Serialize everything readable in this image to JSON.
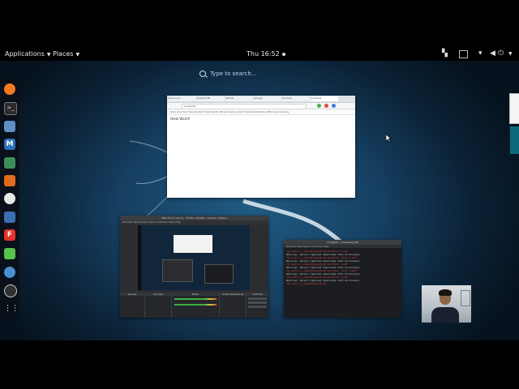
{
  "topbar": {
    "applications_label": "Applications",
    "places_label": "Places",
    "clock": "Thu 16:52"
  },
  "search": {
    "placeholder": "Type to search…"
  },
  "dock": {
    "apps": [
      {
        "name": "firefox-icon",
        "color": "#f47a22"
      },
      {
        "name": "terminal-icon",
        "color": "#2a2a2a"
      },
      {
        "name": "files-icon",
        "color": "#5f8fc4"
      },
      {
        "name": "metasploit-icon",
        "color": "#2d6fb8"
      },
      {
        "name": "armitage-icon",
        "color": "#3b8f5a"
      },
      {
        "name": "burpsuite-icon",
        "color": "#e26b1f"
      },
      {
        "name": "maltego-icon",
        "color": "#e8e8e8"
      },
      {
        "name": "beef-icon",
        "color": "#3a6fb0"
      },
      {
        "name": "faraday-icon",
        "color": "#e5332a"
      },
      {
        "name": "leafpad-icon",
        "color": "#59c24a"
      },
      {
        "name": "cherrytree-icon",
        "color": "#4a8fd0"
      },
      {
        "name": "obs-icon",
        "color": "#303030"
      },
      {
        "name": "show-apps-icon",
        "color": "#ffffff"
      }
    ]
  },
  "windows": {
    "browser": {
      "tabs": [
        "Kali Linux",
        "Exploit-DB",
        "GitHub",
        "Google",
        "YouTube",
        "localhost"
      ],
      "url": "localhost/",
      "bookmarks": "Kali Linux  Kali Training  Kali Tools  Exploit-DB  Aircrack-ng  Kali Forums  NetHunter  Offensive Security",
      "content_text": "Hello World!"
    },
    "obs": {
      "title": "OBS 22.0.3 (linux) - Profile: Untitled - Scenes: Untitled",
      "menu": "File  Edit  View  Profile  Scene Collection  Tools  Help",
      "panels": [
        "Scenes",
        "Sources",
        "Mixer",
        "Scene Transitions",
        "Controls"
      ]
    },
    "terminal": {
      "title": "root@kali: ~/Desktop/pdfs",
      "menu": "File  Edit  View  Search  Terminal  Help",
      "lines": [
        "r@-(kali)-[~/Desktop/pdfs]# exiftool 1.pdf",
        "Warning: [minor] Ignored duplicate Info dictionary",
        "r@-(kali)-[~/Desktop/pdfs]# exiftool -All= 1.pdf",
        "Warning: [minor] Ignored duplicate Info dictionary",
        "r@-(kali)-[~/Desktop/pdfs]# exiftool 1.pdf",
        "Warning: [minor] Ignored duplicate Info dictionary",
        "r@-(kali)-[~/Desktop/pdfs]# exiftool -All= 1.pdf",
        "Warning: [minor] Ignored duplicate Info dictionary",
        "r@-(kali)-[~/Desktop/pdfs]# exiftool 1.pdf",
        "Warning: [minor] Ignored duplicate Info dictionary",
        "r@-(kali)-[~/Desktop/pdfs]# "
      ]
    }
  }
}
